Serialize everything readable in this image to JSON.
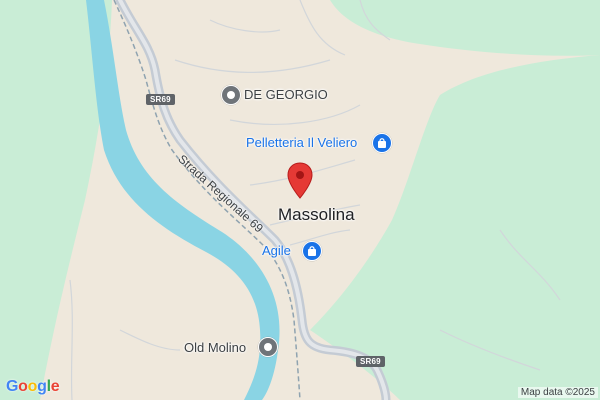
{
  "map": {
    "colors": {
      "land": "#efe8dc",
      "forest": "#c9edd6",
      "water": "#8ad4e4",
      "road": "#c4cbd4",
      "marker": "#e53935",
      "poi_blue": "#1a73e8",
      "poi_gray": "#6f7479"
    },
    "place_label": "Massolina",
    "pois": [
      {
        "name": "DE GEORGIO",
        "icon": "place-icon"
      },
      {
        "name": "Pelletteria Il Veliero",
        "icon": "shopping-bag-icon"
      },
      {
        "name": "Agile",
        "icon": "shopping-bag-icon"
      },
      {
        "name": "Old Molino",
        "icon": "place-icon"
      }
    ],
    "road_label": "Strada Regionale 69",
    "route_shields": [
      "SR69",
      "SR69"
    ],
    "marker": {
      "icon": "location-pin-icon"
    },
    "attribution": "Map data ©2025",
    "logo": {
      "text": "Google",
      "letters": [
        "G",
        "o",
        "o",
        "g",
        "l",
        "e"
      ],
      "letter_colors": [
        "#4285F4",
        "#EA4335",
        "#FBBC05",
        "#4285F4",
        "#34A853",
        "#EA4335"
      ]
    }
  }
}
